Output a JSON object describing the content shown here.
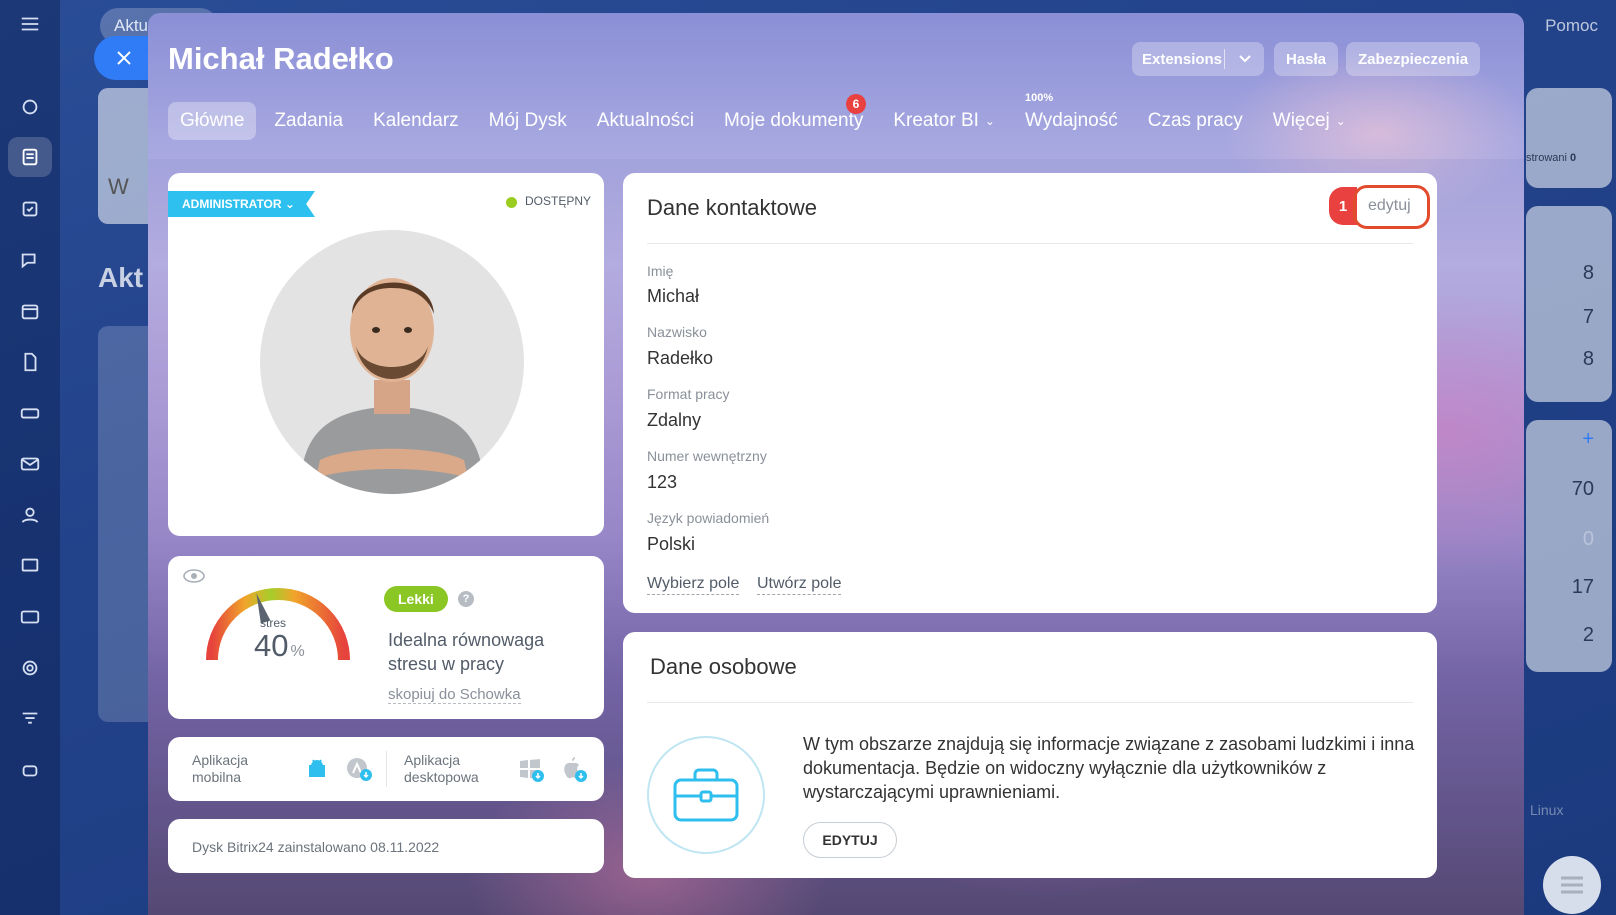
{
  "background": {
    "top_tab": "Aktu",
    "page_heading_fragment": "Akt",
    "card_fragment": "W",
    "help": "Pomoc",
    "right_column": {
      "label": "strowani",
      "label_count": "0",
      "numbers": [
        "8",
        "7",
        "8",
        "70",
        "0",
        "17",
        "2"
      ],
      "linux_text": "Linux"
    }
  },
  "profile": {
    "name": "Michał Radełko",
    "buttons": {
      "extensions": "Extensions",
      "passwords": "Hasła",
      "security": "Zabezpieczenia"
    },
    "tabs": [
      {
        "label": "Główne",
        "active": true
      },
      {
        "label": "Zadania"
      },
      {
        "label": "Kalendarz"
      },
      {
        "label": "Mój Dysk"
      },
      {
        "label": "Aktualności"
      },
      {
        "label": "Moje dokumenty",
        "badge": "6"
      },
      {
        "label": "Kreator BI",
        "dropdown": true
      },
      {
        "label": "Wydajność",
        "mini": "100%"
      },
      {
        "label": "Czas pracy"
      },
      {
        "label": "Więcej",
        "dropdown": true
      }
    ]
  },
  "avatar_card": {
    "role": "ADMINISTRATOR",
    "status": "DOSTĘPNY",
    "status_color": "#9acd1f"
  },
  "stress": {
    "label": "stres",
    "value": "40",
    "unit": "%",
    "value_fraction": 0.4,
    "level": "Lekki",
    "description": "Idealna równowaga stresu w pracy",
    "copy_link": "skopiuj do Schowka"
  },
  "apps": {
    "mobile": "Aplikacja mobilna",
    "desktop": "Aplikacja desktopowa"
  },
  "disk": {
    "text": "Dysk Bitrix24 zainstalowano 08.11.2022"
  },
  "contact": {
    "title": "Dane kontaktowe",
    "edit": "edytuj",
    "callout": "1",
    "fields": [
      {
        "label": "Imię",
        "value": "Michał"
      },
      {
        "label": "Nazwisko",
        "value": "Radełko"
      },
      {
        "label": "Format pracy",
        "value": "Zdalny"
      },
      {
        "label": "Numer wewnętrzny",
        "value": "123"
      },
      {
        "label": "Język powiadomień",
        "value": "Polski"
      }
    ],
    "choose_field": "Wybierz pole",
    "create_field": "Utwórz pole"
  },
  "personal": {
    "title": "Dane osobowe",
    "description": "W tym obszarze znajdują się informacje związane z zasobami ludzkimi i inna dokumentacja. Będzie on widoczny wyłącznie dla użytkowników z wystarczającymi uprawnieniami.",
    "edit_button": "EDYTUJ"
  },
  "colors": {
    "accent_blue": "#2f7cf6",
    "ribbon": "#2ec0ee",
    "callout_red": "#e94040",
    "lekki_green": "#8ac624"
  }
}
